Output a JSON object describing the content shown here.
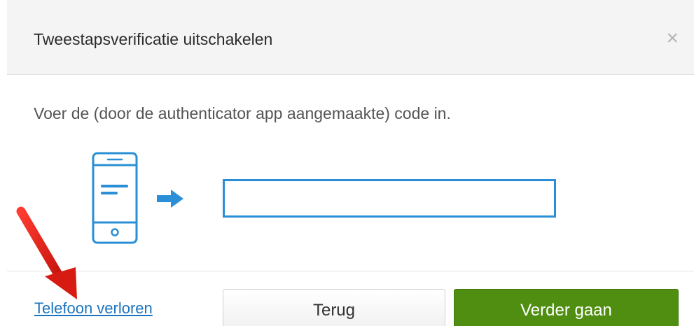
{
  "dialog": {
    "title": "Tweestapsverificatie uitschakelen",
    "close_label": "×"
  },
  "body": {
    "instruction": "Voer de (door de authenticator app aangemaakte) code in.",
    "code_input": {
      "value": "",
      "placeholder": ""
    }
  },
  "footer": {
    "lost_phone_link": "Telefoon verloren",
    "back_button": "Terug",
    "continue_button": "Verder gaan"
  },
  "colors": {
    "accent_blue": "#2a8fd6",
    "continue_green": "#4f8e10",
    "annotation_red": "#e3231b"
  },
  "icons": {
    "phone": "smartphone-icon",
    "arrow": "arrow-right-icon",
    "close": "close-icon",
    "annotation": "red-annotation-arrow"
  }
}
